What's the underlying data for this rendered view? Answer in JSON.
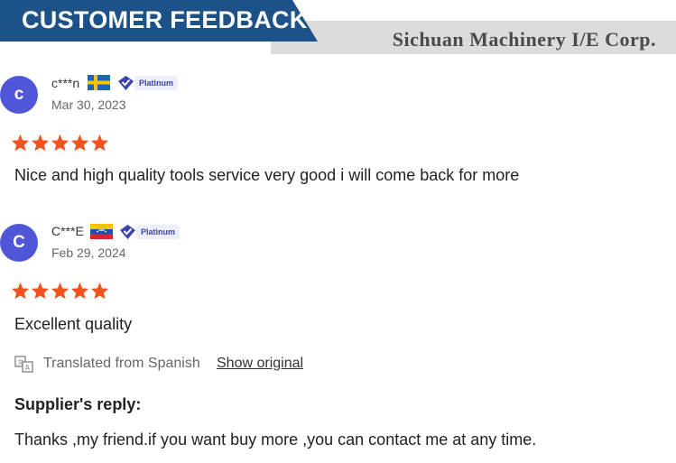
{
  "banner": {
    "title": "CUSTOMER FEEDBACK",
    "company": "Sichuan Machinery I/E Corp."
  },
  "colors": {
    "banner_blue": "#1d5288",
    "avatar": "#4f57d8",
    "star": "#f4511e",
    "badge_blue": "#3b44a8"
  },
  "reviews": [
    {
      "avatar_letter": "c",
      "username": "c***n",
      "flag": "sweden-flag",
      "badge": "Platinum",
      "date": "Mar 30, 2023",
      "rating": 5,
      "text": "Nice and high quality tools service very good i will come back for more"
    },
    {
      "avatar_letter": "C",
      "username": "C***E",
      "flag": "venezuela-flag",
      "badge": "Platinum",
      "date": "Feb 29, 2024",
      "rating": 5,
      "text": "Excellent quality",
      "translation_note": "Translated from Spanish",
      "show_original": "Show original",
      "supplier_reply_title": "Supplier's reply:",
      "supplier_reply": "Thanks ,my friend.if you want buy more ,you can contact me at any time."
    }
  ]
}
